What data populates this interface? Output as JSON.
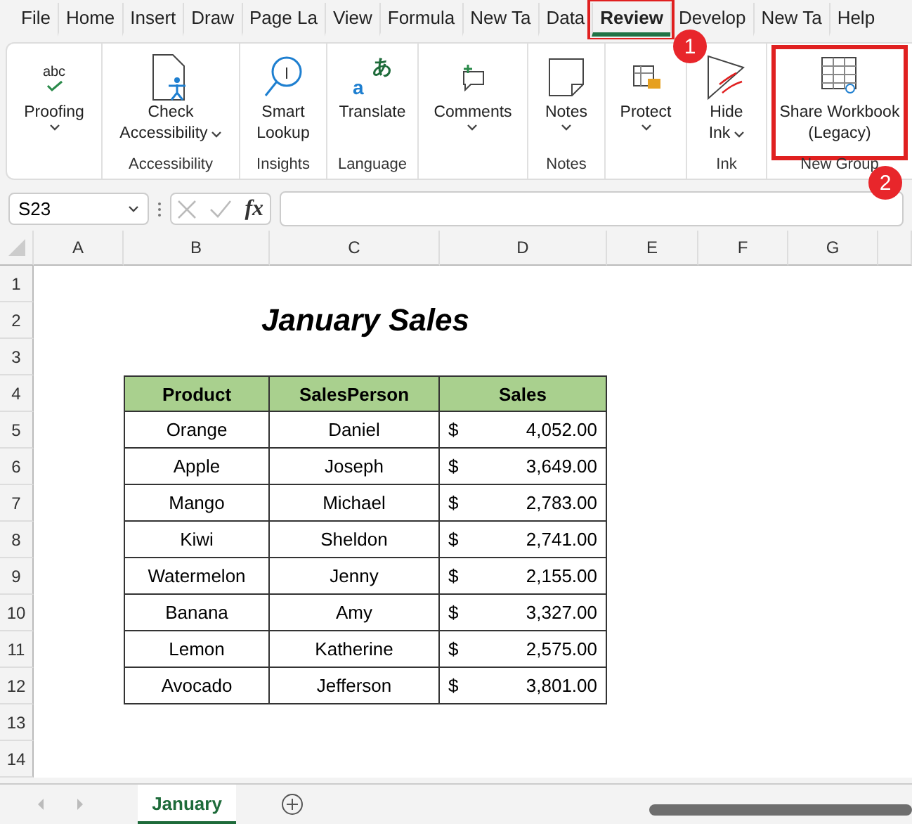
{
  "menu_tabs": [
    {
      "label": "File",
      "selected": false,
      "highlighted": false
    },
    {
      "label": "Home",
      "selected": false,
      "highlighted": false
    },
    {
      "label": "Insert",
      "selected": false,
      "highlighted": false
    },
    {
      "label": "Draw",
      "selected": false,
      "highlighted": false
    },
    {
      "label": "Page La",
      "selected": false,
      "highlighted": false
    },
    {
      "label": "View",
      "selected": false,
      "highlighted": false
    },
    {
      "label": "Formula",
      "selected": false,
      "highlighted": false
    },
    {
      "label": "New Ta",
      "selected": false,
      "highlighted": false
    },
    {
      "label": "Data",
      "selected": false,
      "highlighted": false
    },
    {
      "label": "Review",
      "selected": true,
      "highlighted": true
    },
    {
      "label": "Develop",
      "selected": false,
      "highlighted": false
    },
    {
      "label": "New Ta",
      "selected": false,
      "highlighted": false
    },
    {
      "label": "Help",
      "selected": false,
      "highlighted": false
    }
  ],
  "ribbon_groups": [
    {
      "buttons": [
        {
          "lines": [
            "Proofing"
          ],
          "dropdown": true,
          "highlighted": false,
          "icon_text": [
            "abc"
          ]
        }
      ]
    },
    {
      "label": "Accessibility",
      "buttons": [
        {
          "lines": [
            "Check",
            "Accessibility"
          ],
          "dropdown": true,
          "highlighted": false
        }
      ]
    },
    {
      "label": "Insights",
      "buttons": [
        {
          "lines": [
            "Smart",
            "Lookup"
          ],
          "dropdown": false,
          "highlighted": false
        }
      ]
    },
    {
      "label": "Language",
      "buttons": [
        {
          "lines": [
            "Translate"
          ],
          "dropdown": false,
          "highlighted": false,
          "icon_text": [
            "a",
            "あ"
          ]
        }
      ]
    },
    {
      "buttons": [
        {
          "lines": [
            "Comments"
          ],
          "dropdown": true,
          "highlighted": false
        }
      ]
    },
    {
      "label": "Notes",
      "buttons": [
        {
          "lines": [
            "Notes"
          ],
          "dropdown": true,
          "highlighted": false
        }
      ]
    },
    {
      "buttons": [
        {
          "lines": [
            "Protect"
          ],
          "dropdown": true,
          "highlighted": false
        }
      ]
    },
    {
      "label": "Ink",
      "buttons": [
        {
          "lines": [
            "Hide",
            "Ink"
          ],
          "dropdown": true,
          "highlighted": false
        }
      ]
    },
    {
      "label": "New Group",
      "buttons": [
        {
          "lines": [
            "Share Workbook",
            "(Legacy)"
          ],
          "dropdown": false,
          "highlighted": true
        }
      ]
    }
  ],
  "callouts": [
    "1",
    "2"
  ],
  "formula_bar": {
    "name_box": "S23",
    "fx_label": "fx"
  },
  "columns": [
    "A",
    "B",
    "C",
    "D",
    "E",
    "F",
    "G"
  ],
  "row_numbers": [
    "1",
    "2",
    "3",
    "4",
    "5",
    "6",
    "7",
    "8",
    "9",
    "10",
    "11",
    "12",
    "13",
    "14"
  ],
  "sheet": {
    "title": "January Sales",
    "headers": [
      "Product",
      "SalesPerson",
      "Sales"
    ],
    "rows": [
      [
        "Orange",
        "Daniel",
        {
          "currency": "$",
          "amount": "4,052.00"
        }
      ],
      [
        "Apple",
        "Joseph",
        {
          "currency": "$",
          "amount": "3,649.00"
        }
      ],
      [
        "Mango",
        "Michael",
        {
          "currency": "$",
          "amount": "2,783.00"
        }
      ],
      [
        "Kiwi",
        "Sheldon",
        {
          "currency": "$",
          "amount": "2,741.00"
        }
      ],
      [
        "Watermelon",
        "Jenny",
        {
          "currency": "$",
          "amount": "2,155.00"
        }
      ],
      [
        "Banana",
        "Amy",
        {
          "currency": "$",
          "amount": "3,327.00"
        }
      ],
      [
        "Lemon",
        "Katherine",
        {
          "currency": "$",
          "amount": "2,575.00"
        }
      ],
      [
        "Avocado",
        "Jefferson",
        {
          "currency": "$",
          "amount": "3,801.00"
        }
      ]
    ]
  },
  "sheet_tabs": [
    {
      "label": "January",
      "selected": true
    }
  ]
}
